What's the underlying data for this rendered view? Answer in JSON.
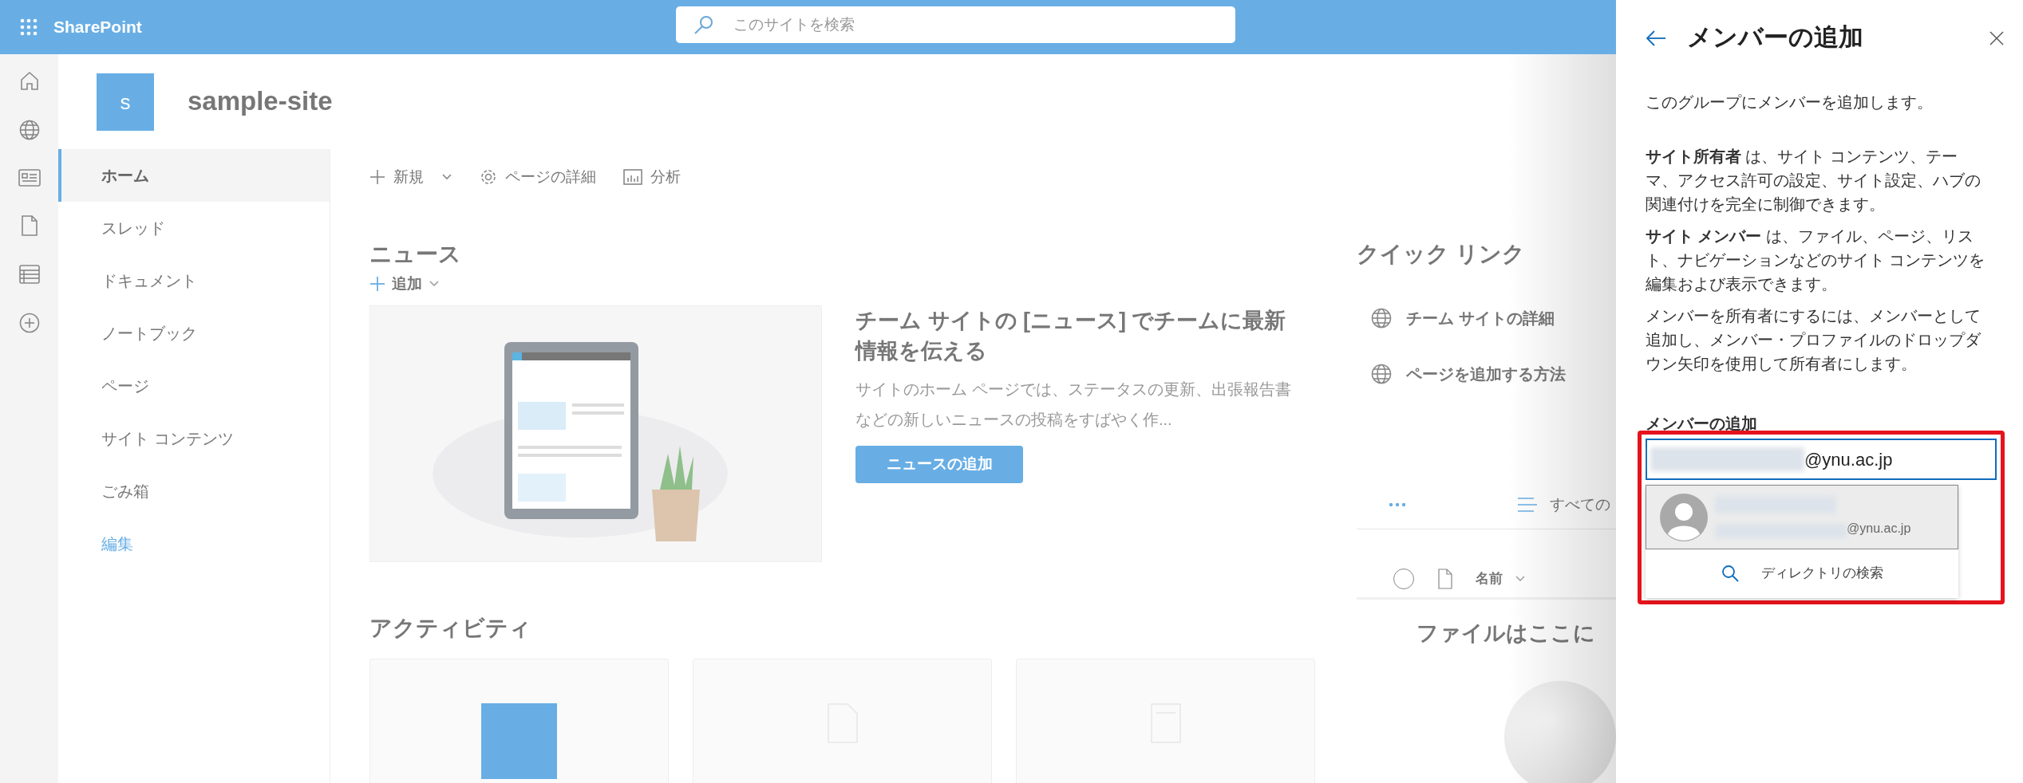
{
  "top_bar": {
    "app_name": "SharePoint",
    "search": {
      "placeholder": "このサイトを検索"
    }
  },
  "site": {
    "logo_letter": "s",
    "title": "sample-site"
  },
  "nav": {
    "items": [
      {
        "label": "ホーム",
        "selected": true,
        "kind": "page"
      },
      {
        "label": "スレッド",
        "selected": false,
        "kind": "page"
      },
      {
        "label": "ドキュメント",
        "selected": false,
        "kind": "page"
      },
      {
        "label": "ノートブック",
        "selected": false,
        "kind": "page"
      },
      {
        "label": "ページ",
        "selected": false,
        "kind": "page"
      },
      {
        "label": "サイト コンテンツ",
        "selected": false,
        "kind": "page"
      },
      {
        "label": "ごみ箱",
        "selected": false,
        "kind": "page"
      },
      {
        "label": "編集",
        "selected": false,
        "kind": "edit"
      }
    ]
  },
  "command_bar": [
    {
      "label": "新規",
      "kind": "new"
    },
    {
      "label": "ページの詳細",
      "kind": "details"
    },
    {
      "label": "分析",
      "kind": "analytics"
    }
  ],
  "news": {
    "title": "ニュース",
    "add_label": "追加",
    "headline": "チーム サイトの [ニュース] でチームに最新情報を伝える",
    "description": "サイトのホーム ページでは、ステータスの更新、出張報告書などの新しいニュースの投稿をすばやく作...",
    "button": "ニュースの追加"
  },
  "activity": {
    "title": "アクティビティ",
    "cards": [
      {
        "kind": "site"
      },
      {
        "kind": "document"
      },
      {
        "kind": "page"
      }
    ]
  },
  "quick_links": {
    "title": "クイック リンク",
    "items": [
      {
        "label": "チーム サイトの詳細"
      },
      {
        "label": "ページを追加する方法"
      }
    ]
  },
  "documents": {
    "view_label": "すべての",
    "column": "名前",
    "empty_message": "ファイルはここに"
  },
  "panel": {
    "title": "メンバーの追加",
    "intro": "このグループにメンバーを追加します。",
    "paragraphs": [
      "**サイト所有者** は、サイト コンテンツ、テーマ、アクセス許可の設定、サイト設定、ハブの関連付けを完全に制御できます。",
      "**サイト メンバー** は、ファイル、ページ、リスト、ナビゲーションなどのサイト コンテンツを編集および表示できます。",
      "メンバーを所有者にするには、メンバーとして追加し、メンバー・プロファイルのドロップダウン矢印を使用して所有者にします。"
    ],
    "field_label": "メンバーの追加",
    "input_value": "@ynu.ac.jp",
    "suggestions": [
      {
        "email": "@ynu.ac.jp",
        "selected": true
      }
    ],
    "directory_search": "ディレクトリの検索"
  }
}
